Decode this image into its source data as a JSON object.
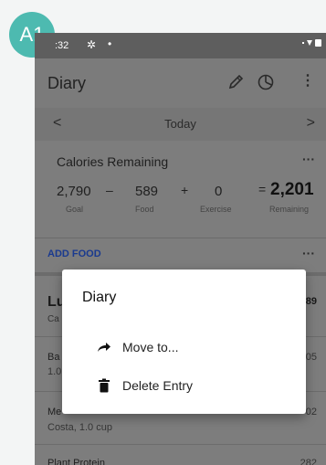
{
  "badge": {
    "label": "A1"
  },
  "status_bar": {
    "time": ":32"
  },
  "toolbar": {
    "title": "Diary"
  },
  "date_nav": {
    "label": "Today",
    "prev": "<",
    "next": ">"
  },
  "calories": {
    "title": "Calories Remaining",
    "goal": "2,790",
    "food": "589",
    "exercise": "0",
    "remaining": "2,201",
    "ops": {
      "minus": "–",
      "plus": "+",
      "equals": "="
    },
    "labels": {
      "goal": "Goal",
      "food": "Food",
      "exercise": "Exercise",
      "remaining": "Remaining"
    }
  },
  "add_food": {
    "label": "ADD FOOD",
    "more": "···"
  },
  "lunch": {
    "title": "Lu",
    "subtitle": "Ca",
    "calories": "89"
  },
  "entries": [
    {
      "name": "Ba",
      "sub": "1.0",
      "calories": "05"
    },
    {
      "name": "Me",
      "sub": "Costa, 1.0 cup",
      "calories": "02"
    },
    {
      "name": "Plant Protein",
      "sub": "",
      "calories": "282"
    }
  ],
  "dialog": {
    "title": "Diary",
    "options": [
      {
        "label": "Move to...",
        "icon": "forward-arrow-icon"
      },
      {
        "label": "Delete Entry",
        "icon": "trash-icon"
      }
    ]
  },
  "colors": {
    "badge": "#4dbab0",
    "link": "#1a3a8f",
    "statusbar": "#5e5e5e"
  }
}
